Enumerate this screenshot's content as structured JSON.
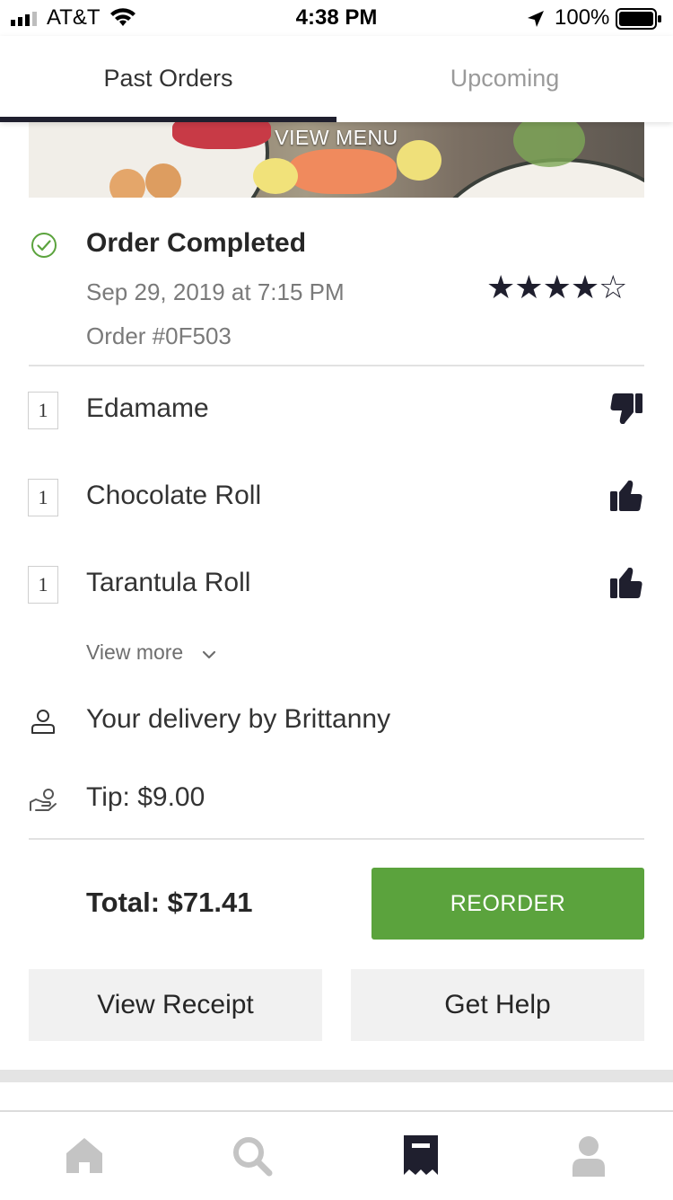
{
  "status_bar": {
    "carrier": "AT&T",
    "time": "4:38 PM",
    "battery": "100%"
  },
  "tabs": [
    {
      "label": "Past Orders",
      "active": true
    },
    {
      "label": "Upcoming",
      "active": false
    }
  ],
  "hero": {
    "label": "VIEW MENU"
  },
  "order": {
    "status": "Order Completed",
    "date": "Sep 29, 2019 at 7:15 PM",
    "number": "Order #0F503",
    "rating": 4,
    "rating_max": 5,
    "items": [
      {
        "qty": "1",
        "name": "Edamame",
        "feedback": "thumbs-down"
      },
      {
        "qty": "1",
        "name": "Chocolate Roll",
        "feedback": "thumbs-up"
      },
      {
        "qty": "1",
        "name": "Tarantula Roll",
        "feedback": "thumbs-up"
      }
    ],
    "view_more": "View more",
    "delivery": "Your delivery by Brittanny",
    "tip": "Tip: $9.00",
    "total": "Total: $71.41"
  },
  "actions": {
    "reorder": "REORDER",
    "view_receipt": "View Receipt",
    "get_help": "Get Help"
  },
  "nav": [
    {
      "icon": "home-icon",
      "active": false
    },
    {
      "icon": "search-icon",
      "active": false
    },
    {
      "icon": "orders-icon",
      "active": true
    },
    {
      "icon": "account-icon",
      "active": false
    }
  ],
  "colors": {
    "accent_green": "#5ba33d",
    "check_green": "#5ba33d",
    "dark": "#1f1f2e",
    "inactive_nav": "#c4c4c4"
  }
}
